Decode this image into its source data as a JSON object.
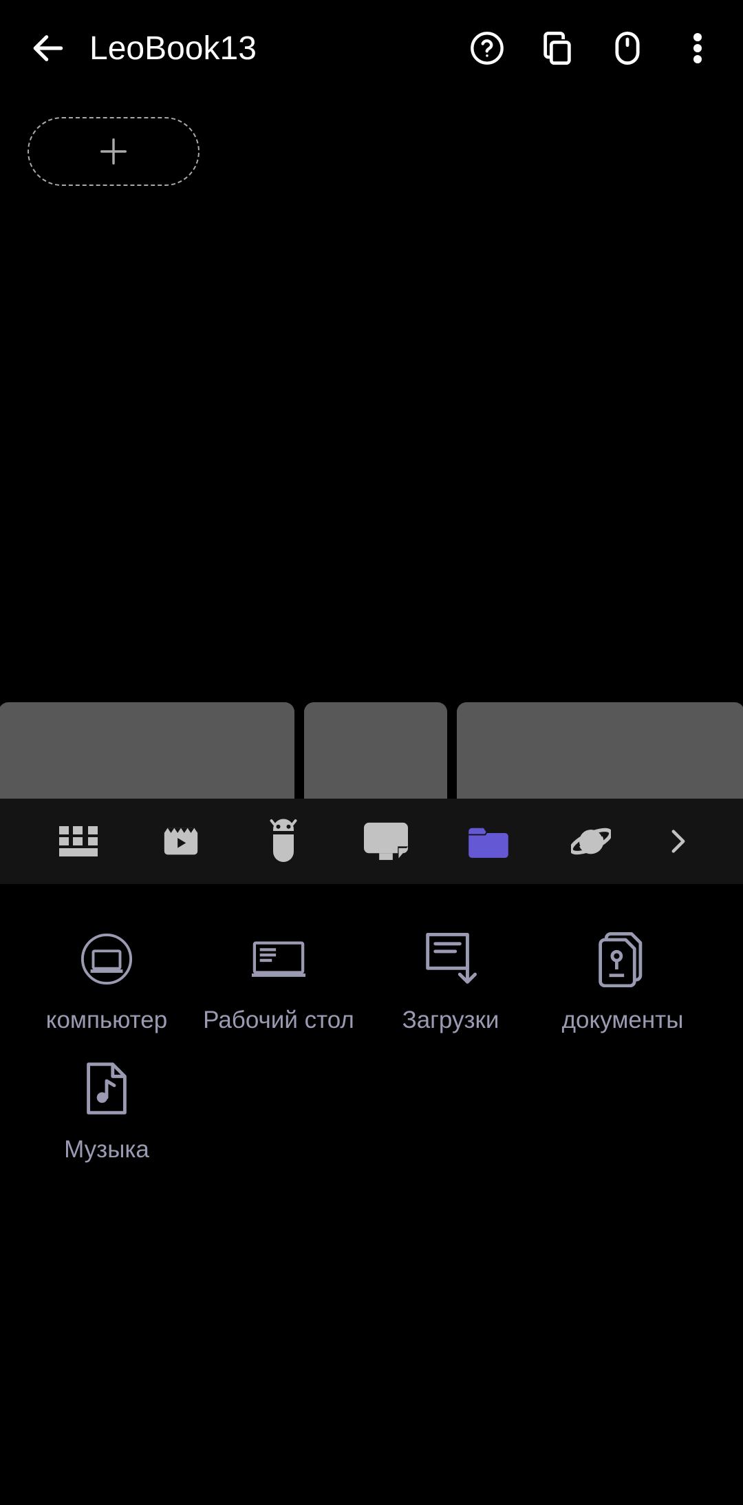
{
  "header": {
    "title": "LeoBook13"
  },
  "tabs": {
    "activeIndex": 4
  },
  "folders": [
    {
      "label": "компьютер",
      "icon": "computer"
    },
    {
      "label": "Рабочий стол",
      "icon": "desktop"
    },
    {
      "label": "Загрузки",
      "icon": "downloads"
    },
    {
      "label": "документы",
      "icon": "documents"
    },
    {
      "label": "Музыка",
      "icon": "music"
    }
  ],
  "colors": {
    "accent": "#6558d4",
    "inactive": "#c2c2c2",
    "folderIcon": "#9a9bb3"
  }
}
